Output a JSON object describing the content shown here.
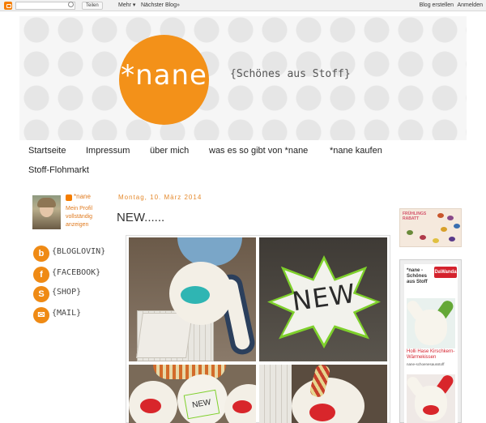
{
  "navbar": {
    "share_label": "Teilen",
    "more_label": "Mehr",
    "next_blog_label": "Nächster Blog»",
    "create_blog_label": "Blog erstellen",
    "login_label": "Anmelden"
  },
  "header": {
    "logo_text": "*nane",
    "tagline": "{Schönes aus Stoff}"
  },
  "nav": {
    "tabs": [
      "Startseite",
      "Impressum",
      "über mich",
      "was es so gibt von *nane",
      "*nane kaufen",
      "Stoff-Flohmarkt"
    ]
  },
  "profile": {
    "name": "*nane",
    "link": "Mein Profil vollständig anzeigen"
  },
  "social": [
    {
      "glyph": "b",
      "label": "{BLOGLOVIN}"
    },
    {
      "glyph": "f",
      "label": "{FACEBOOK}"
    },
    {
      "glyph": "S",
      "label": "{SHOP}"
    },
    {
      "glyph": "✉",
      "label": "{MAIL}"
    }
  ],
  "post": {
    "date": "Montag, 10. März 2014",
    "title": "NEW......",
    "photo_star_text": "NEW",
    "photo_small_star_text": "NEW"
  },
  "sidebar": {
    "ad_text": "FRÜHLINGS RABATT",
    "dawanda_title": "*nane - Schönes aus Stoff",
    "dawanda_badge": "DaWanda",
    "dawanda_item_title": "Holli Hase Kirschkern-Wärmekissen",
    "dawanda_item_sub": "nane-schoenesausstoff"
  },
  "colors": {
    "brand_orange": "#f39119",
    "accent_orange": "#e07b20",
    "dawanda_red": "#d4222d"
  }
}
